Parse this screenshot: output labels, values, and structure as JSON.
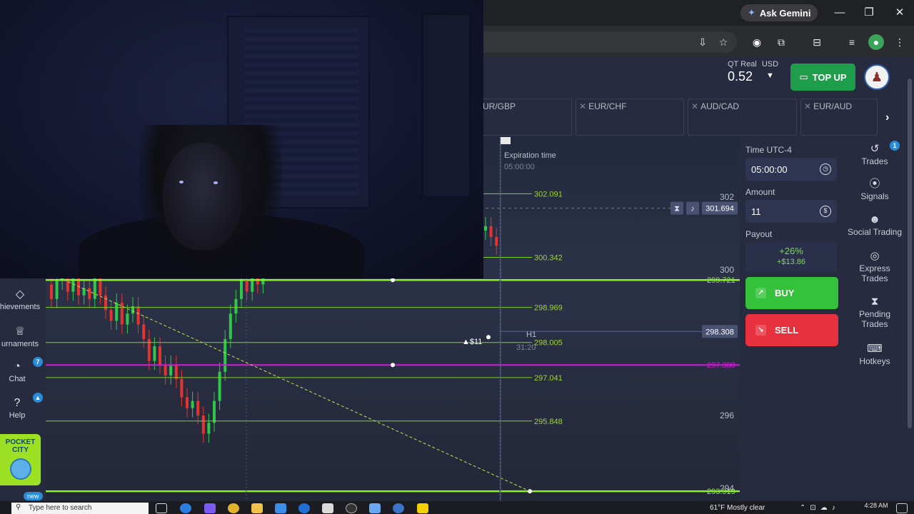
{
  "browser": {
    "gemini_label": "Ask Gemini",
    "window_controls": {
      "minimize_icon": "minimize-icon",
      "maximize_icon": "maximize-icon",
      "close_icon": "close-icon"
    }
  },
  "header": {
    "balance_account": "QT Real",
    "balance_currency": "USD",
    "balance_value": "0.52",
    "topup_label": "TOP UP"
  },
  "asset_tabs": [
    {
      "label": "UR/GBP"
    },
    {
      "label": "EUR/CHF"
    },
    {
      "label": "AUD/CAD"
    },
    {
      "label": "EUR/AUD"
    }
  ],
  "chart": {
    "expiration_label": "Expiration time",
    "expiration_value": "05:00:00",
    "timeframe": "H1",
    "countdown": "31:20",
    "trade_marker": "$11",
    "current_price": "298.308",
    "alert_price": "301.694",
    "level_magenta": "297.388",
    "axis_ticks": [
      "302",
      "300",
      "296",
      "294"
    ],
    "levels": [
      "302.091",
      "300.342",
      "299.721",
      "298.969",
      "298.005",
      "297.041",
      "295.848",
      "293.919"
    ],
    "colors": {
      "green_level": "#7ed321",
      "bright_level": "#8cf02a",
      "magenta": "#d21ad6",
      "candle_up": "#2ec84a",
      "candle_down": "#e5332f"
    }
  },
  "trade_panel": {
    "time_label": "Time UTC-4",
    "time_value": "05:00:00",
    "amount_label": "Amount",
    "amount_value": "11",
    "payout_label": "Payout",
    "payout_pct": "+26%",
    "payout_amt": "+$13.86",
    "buy_label": "BUY",
    "sell_label": "SELL"
  },
  "right_sidebar": {
    "items": [
      {
        "label": "Trades",
        "icon": "history-icon",
        "badge": "1"
      },
      {
        "label": "Signals",
        "icon": "signal-icon"
      },
      {
        "label": "Social Trading",
        "icon": "people-icon"
      },
      {
        "label": "Express Trades",
        "icon": "target-icon"
      },
      {
        "label": "Pending Trades",
        "icon": "hourglass-icon"
      },
      {
        "label": "Hotkeys",
        "icon": "keyboard-icon"
      }
    ]
  },
  "left_sidebar": {
    "items": [
      {
        "label": "hievements",
        "icon": "diamond-icon"
      },
      {
        "label": "urnaments",
        "icon": "trophy-icon"
      },
      {
        "label": "Chat",
        "icon": "chat-icon",
        "badge": "7"
      },
      {
        "label": "Help",
        "icon": "help-icon"
      }
    ],
    "promo_title": "POCKET CITY",
    "new_label": "new"
  },
  "taskbar": {
    "search_placeholder": "Type here to search",
    "weather": "61°F  Mostly clear",
    "time": "4:28 AM"
  }
}
